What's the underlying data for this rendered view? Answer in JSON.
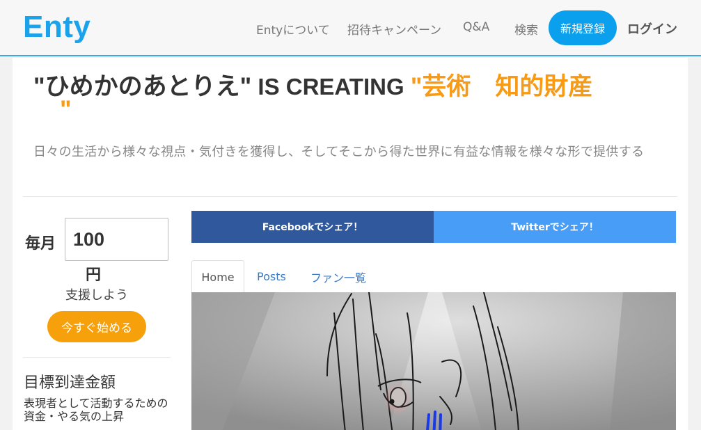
{
  "header": {
    "logo": "Enty",
    "nav": {
      "about": "Entyについて",
      "invite": "招待キャンペーン",
      "qa": "Q&A",
      "search": "検索"
    },
    "register": "新規登録",
    "login": "ログイン",
    "colors": {
      "brand": "#1aa3ea",
      "register_bg": "#0aa0ee"
    }
  },
  "hero": {
    "quote_open": "\"",
    "creator": "ひめかのあとりえ",
    "quote_mid": "\"",
    "is_creating": " IS CREATING ",
    "category_quote_open": "\"",
    "category": "芸術　知的財産",
    "category_quote_close": "\"",
    "description": "日々の生活から様々な視点・気付きを獲得し、そしてそこから得た世界に有益な情報を様々な形で提供する",
    "accent_color": "#f79a15"
  },
  "support": {
    "monthly_label": "毎月",
    "amount": "100",
    "currency": "円",
    "support_text": "支援しよう",
    "start_button": "今すぐ始める"
  },
  "goal": {
    "title": "目標到達金額",
    "description": "表現者として活動するための資金・やる気の上昇"
  },
  "share": {
    "facebook": "Facebookでシェア！",
    "twitter": "Twitterでシェア！",
    "facebook_color": "#30589c",
    "twitter_color": "#489ef7"
  },
  "tabs": {
    "home": "Home",
    "posts": "Posts",
    "fans": "ファン一覧"
  }
}
